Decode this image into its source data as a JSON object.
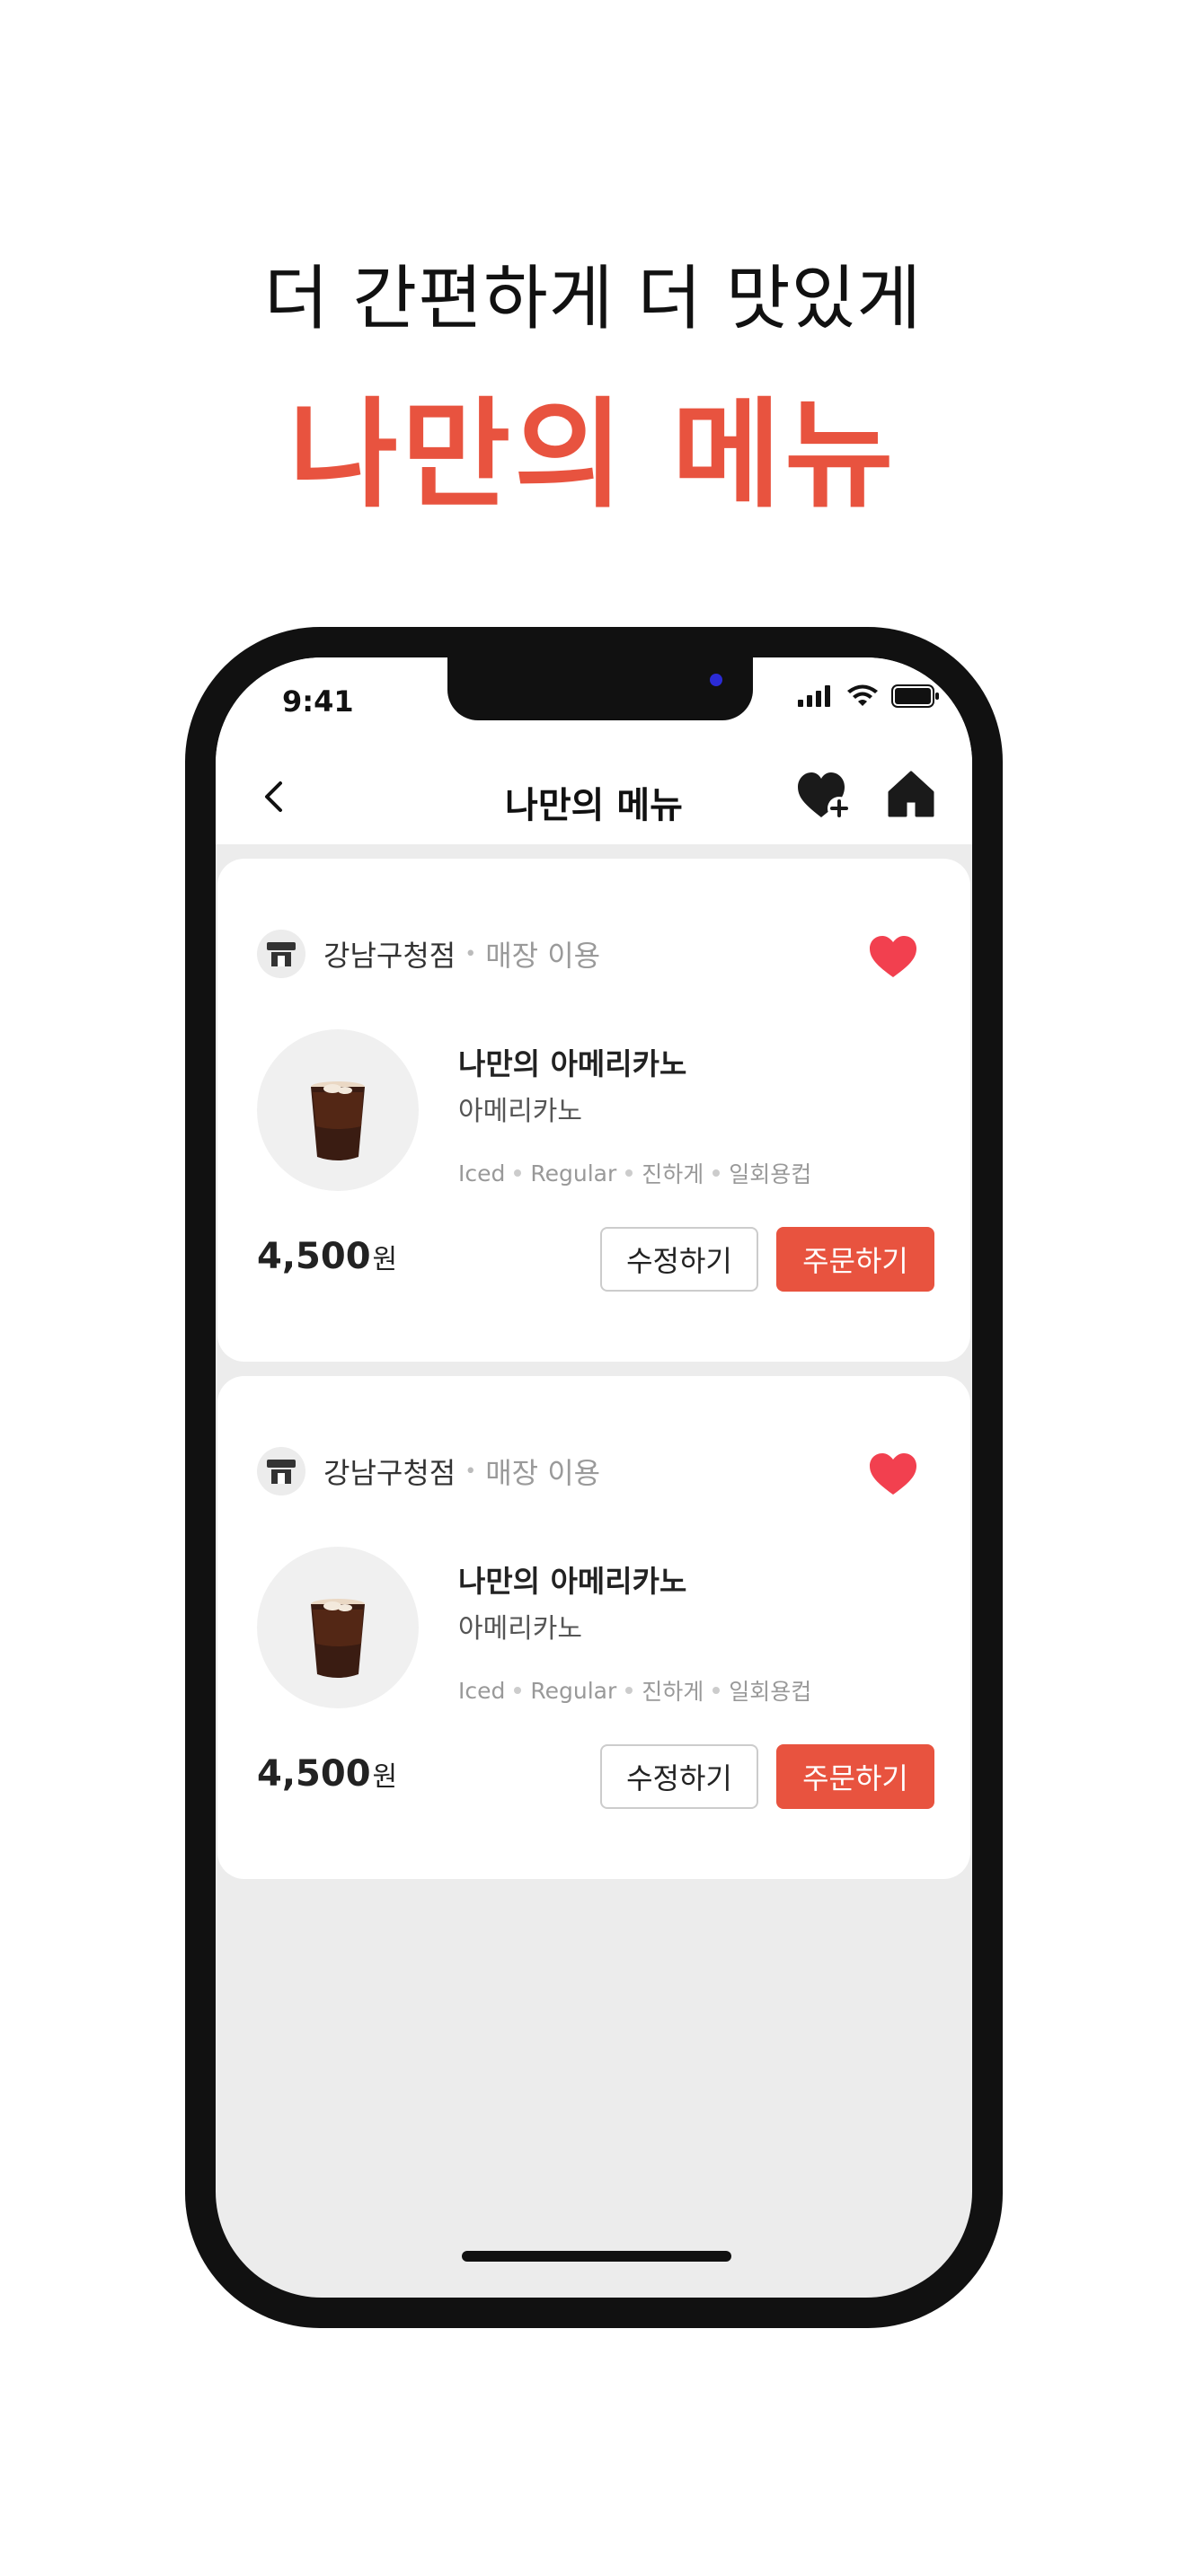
{
  "headline": {
    "sub": "더 간편하게 더 맛있게",
    "main": "나만의 메뉴"
  },
  "status_bar": {
    "time": "9:41"
  },
  "nav": {
    "title": "나만의 메뉴"
  },
  "cards": [
    {
      "store_name": "강남구청점",
      "store_mode": "매장 이용",
      "favorited": true,
      "item_name": "나만의 아메리카노",
      "item_base": "아메리카노",
      "options": [
        "Iced",
        "Regular",
        "진하게",
        "일회용컵"
      ],
      "price": "4,500",
      "price_unit": "원",
      "edit_label": "수정하기",
      "order_label": "주문하기"
    },
    {
      "store_name": "강남구청점",
      "store_mode": "매장 이용",
      "favorited": true,
      "item_name": "나만의 아메리카노",
      "item_base": "아메리카노",
      "options": [
        "Iced",
        "Regular",
        "진하게",
        "일회용컵"
      ],
      "price": "4,500",
      "price_unit": "원",
      "edit_label": "수정하기",
      "order_label": "주문하기"
    }
  ],
  "colors": {
    "accent": "#e8533f",
    "heart": "#f2404f",
    "background": "#ececec"
  },
  "icons": [
    "back-chevron-icon",
    "heart-plus-icon",
    "home-icon",
    "store-icon",
    "heart-icon",
    "signal-icon",
    "wifi-icon",
    "battery-icon"
  ]
}
